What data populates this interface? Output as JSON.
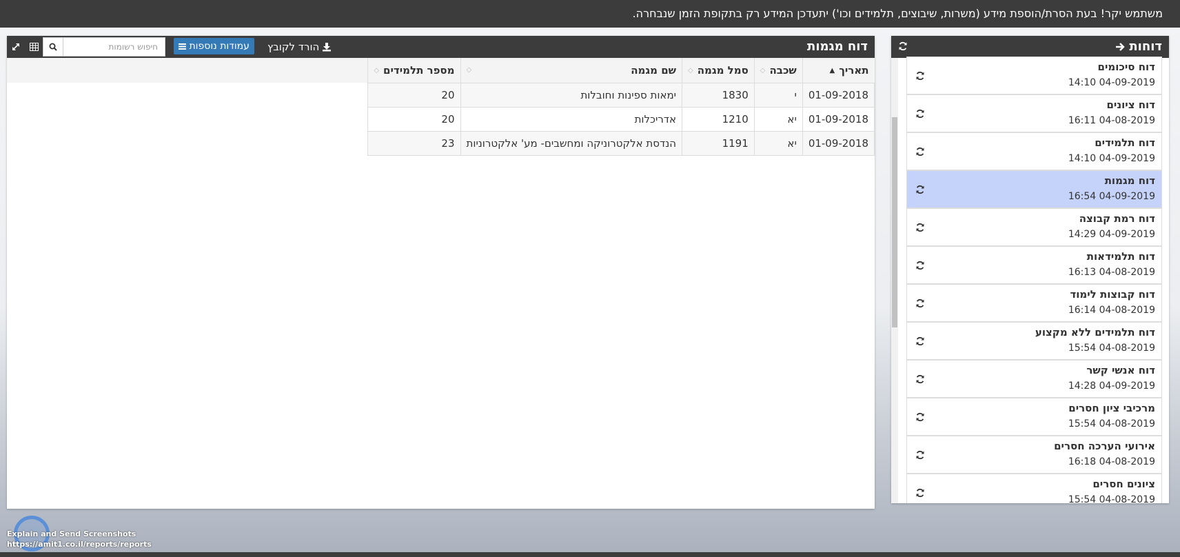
{
  "notice": {
    "text": "משתמש יקר! בעת הסרת/הוספת מידע (משרות, שיבוצים, תלמידים וכו') יתעדכן המידע רק בתקופת הזמן שנבחרה."
  },
  "main": {
    "title": "דוח מגמות",
    "download_label": "הורד לקובץ",
    "columns_label": "עמודות נוספות",
    "search_placeholder": "חיפוש רשומות",
    "table": {
      "headers": [
        "תאריך",
        "שכבה",
        "סמל מגמה",
        "שם מגמה",
        "מספר תלמידים"
      ],
      "rows": [
        [
          "01-09-2018",
          "י",
          "1830",
          "ימאות ספינות וחובלות",
          "20"
        ],
        [
          "01-09-2018",
          "יא",
          "1210",
          "אדריכלות",
          "20"
        ],
        [
          "01-09-2018",
          "יא",
          "1191",
          "הנדסת אלקטרוניקה ומחשבים- מע' אלקטרוניות",
          "23"
        ]
      ]
    }
  },
  "side": {
    "title": "דוחות",
    "items": [
      {
        "name": "דוח סיכומים",
        "time": "14:10 04-09-2019",
        "selected": false
      },
      {
        "name": "דוח ציונים",
        "time": "16:11 04-08-2019",
        "selected": false
      },
      {
        "name": "דוח תלמידים",
        "time": "14:10 04-09-2019",
        "selected": false
      },
      {
        "name": "דוח מגמות",
        "time": "16:54 04-09-2019",
        "selected": true
      },
      {
        "name": "דוח רמת קבוצה",
        "time": "14:29 04-09-2019",
        "selected": false
      },
      {
        "name": "דוח תלמידאות",
        "time": "16:13 04-08-2019",
        "selected": false
      },
      {
        "name": "דוח קבוצות לימוד",
        "time": "16:14 04-08-2019",
        "selected": false
      },
      {
        "name": "דוח תלמידים ללא מקצוע",
        "time": "15:54 04-08-2019",
        "selected": false
      },
      {
        "name": "דוח אנשי קשר",
        "time": "14:28 04-09-2019",
        "selected": false
      },
      {
        "name": "מרכיבי ציון חסרים",
        "time": "15:54 04-08-2019",
        "selected": false
      },
      {
        "name": "אירועי הערכה חסרים",
        "time": "16:18 04-08-2019",
        "selected": false
      },
      {
        "name": "ציונים חסרים",
        "time": "15:54 04-08-2019",
        "selected": false
      }
    ]
  },
  "overlay": {
    "line1": "Explain and Send Screenshots",
    "line2": "https://amit1.co.il/reports/reports"
  },
  "colors": {
    "dark": "#3b3c3b",
    "accent": "#337ab7",
    "selected": "#c5d3fb"
  },
  "icons": [
    "download-icon",
    "list-icon",
    "search-icon",
    "grid-icon",
    "expand-icon",
    "refresh-icon",
    "arrow-right-icon",
    "sort-icon"
  ]
}
